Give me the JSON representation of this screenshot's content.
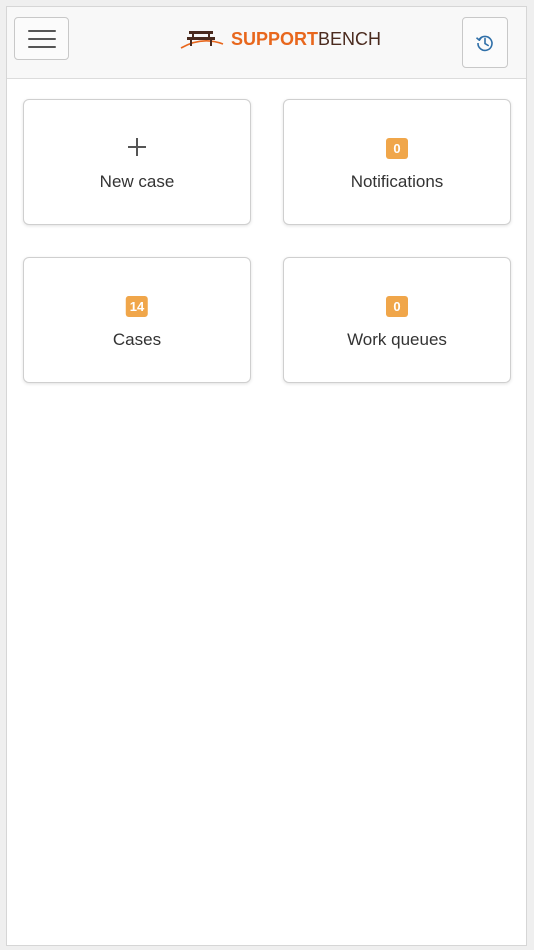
{
  "header": {
    "logo": {
      "part1": "SUPPORT",
      "part2": "BENCH",
      "icon": "bench-icon"
    },
    "menu_icon": "hamburger-menu-icon",
    "history_icon": "history-icon"
  },
  "tiles": [
    {
      "label": "New case",
      "icon": "plus-icon"
    },
    {
      "label": "Notifications",
      "badge": "0"
    },
    {
      "label": "Cases",
      "badge": "14"
    },
    {
      "label": "Work queues",
      "badge": "0"
    }
  ],
  "colors": {
    "accent": "#e8671d",
    "badge": "#f0a64a",
    "history_icon": "#2f6fa8"
  }
}
